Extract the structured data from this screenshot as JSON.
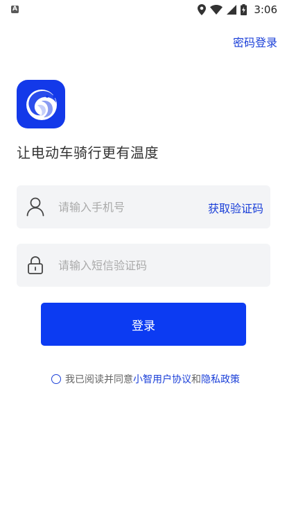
{
  "status_bar": {
    "notification_icon": "A",
    "time": "3:06",
    "icons": [
      "location-icon",
      "wifi-icon",
      "cellular-icon",
      "battery-icon"
    ]
  },
  "header": {
    "password_login_label": "密码登录"
  },
  "brand": {
    "logo_icon": "eagle-logo-icon",
    "slogan": "让电动车骑行更有温度",
    "primary_color": "#1339e9"
  },
  "form": {
    "phone_placeholder": "请输入手机号",
    "phone_value": "",
    "get_code_label": "获取验证码",
    "code_placeholder": "请输入短信验证码",
    "code_value": "",
    "login_label": "登录"
  },
  "agreement": {
    "checked": false,
    "prefix": "我已阅读并同意",
    "user_agreement": "小智用户协议",
    "and": "和",
    "privacy_policy": "隐私政策"
  }
}
